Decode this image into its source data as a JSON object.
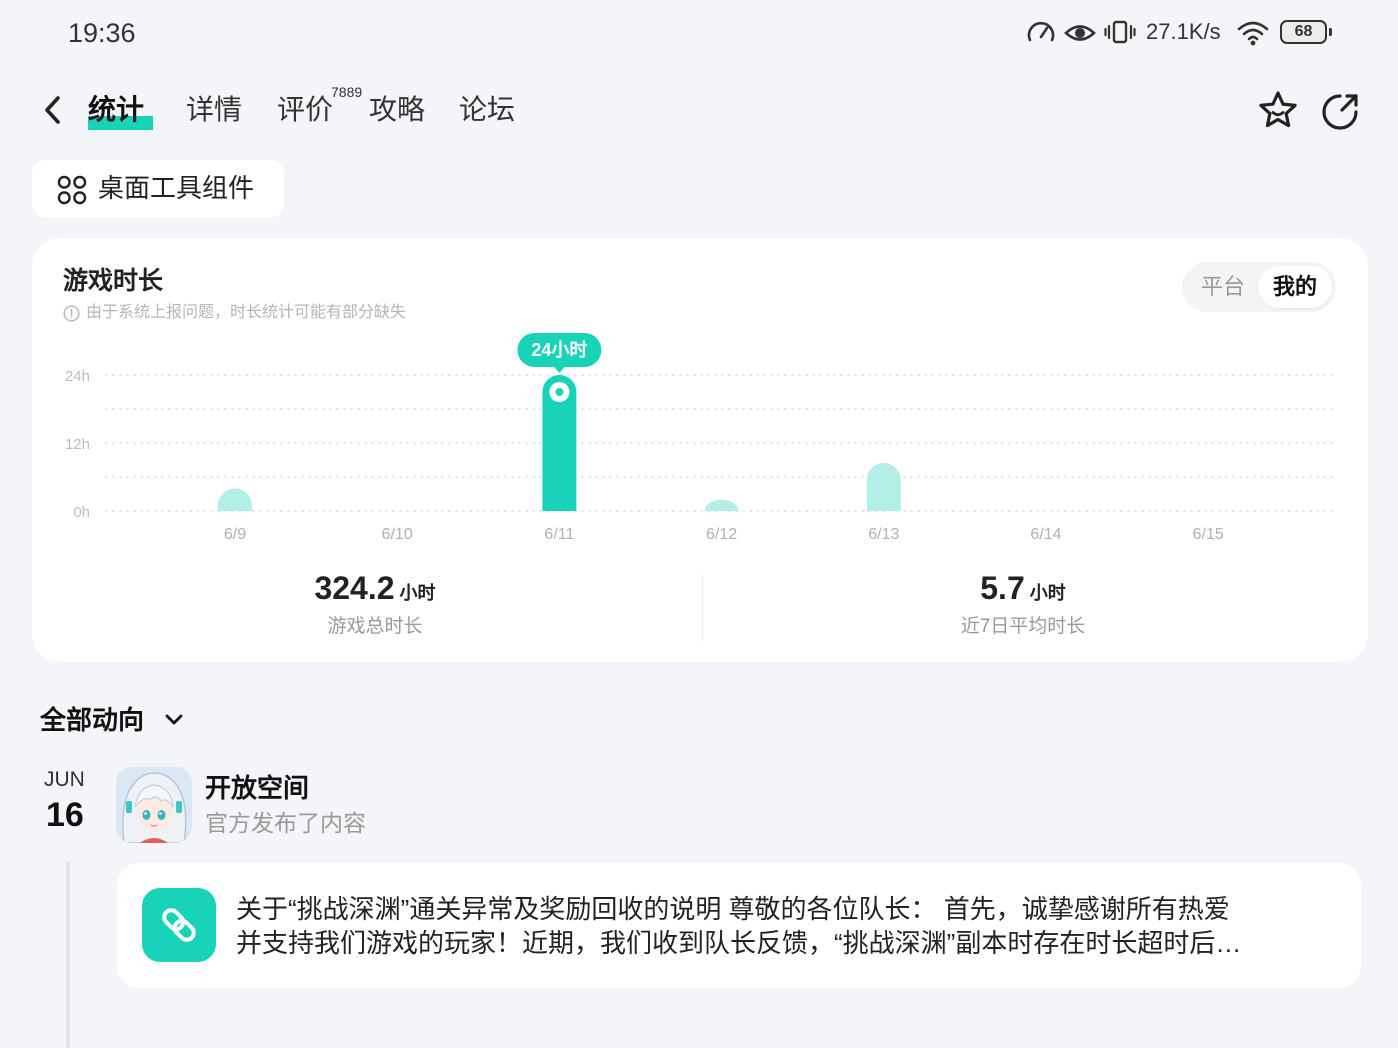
{
  "status_bar": {
    "time": "19:36",
    "net_speed": "27.1K/s",
    "battery": "68",
    "icons": [
      "speedometer-icon",
      "eye-icon",
      "vibrate-icon",
      "wifi-icon",
      "battery-icon"
    ]
  },
  "nav": {
    "back_icon": "chevron-left-icon",
    "tabs": [
      {
        "label": "统计",
        "active": true
      },
      {
        "label": "详情"
      },
      {
        "label": "评价",
        "badge": "7889"
      },
      {
        "label": "攻略"
      },
      {
        "label": "论坛"
      }
    ],
    "actions": [
      "star-icon",
      "share-icon"
    ]
  },
  "widget_button": {
    "label": "桌面工具组件",
    "icon": "grid-icon"
  },
  "playtime": {
    "note_icon": "info-icon",
    "note": "由于系统上报问题，时长统计可能有部分缺失",
    "toggle": [
      {
        "label": "平台"
      },
      {
        "label": "我的",
        "selected": true
      }
    ],
    "total": {
      "value": "324.2",
      "unit": "小时",
      "label": "游戏总时长"
    },
    "average": {
      "value": "5.7",
      "unit": "小时",
      "label": "近7日平均时长"
    }
  },
  "chart_data": {
    "type": "bar",
    "title": "游戏时长",
    "categories": [
      "6/9",
      "6/10",
      "6/11",
      "6/12",
      "6/13",
      "6/14",
      "6/15"
    ],
    "values": [
      4,
      0,
      24,
      2,
      8.5,
      0,
      0
    ],
    "ylim": [
      0,
      24
    ],
    "y_ticks": [
      {
        "value": 24,
        "label": "24h"
      },
      {
        "value": 12,
        "label": "12h"
      },
      {
        "value": 0,
        "label": "0h"
      }
    ],
    "grid": true,
    "highlight": {
      "category": "6/11",
      "label": "24小时"
    },
    "colors": {
      "bar": "#b4efe7",
      "highlight": "#19d3b9"
    }
  },
  "feed": {
    "filter_label": "全部动向",
    "filter_icon": "chevron-down-icon",
    "items": [
      {
        "month": "JUN",
        "day": "16",
        "avatar": "anime-girl-avatar",
        "author": "开放空间",
        "action": "官方发布了内容",
        "post_icon": "link-icon",
        "text_line1": "关于“挑战深渊”通关异常及奖励回收的说明 尊敬的各位队长：  首先，诚挚感谢所有热爱",
        "text_line2": "并支持我们游戏的玩家！近期，我们收到队长反馈，“挑战深渊”副本时存在时长超时后…"
      }
    ]
  },
  "colors": {
    "accent": "#19d3b9",
    "background": "#f4f5f8",
    "card": "#ffffff"
  }
}
